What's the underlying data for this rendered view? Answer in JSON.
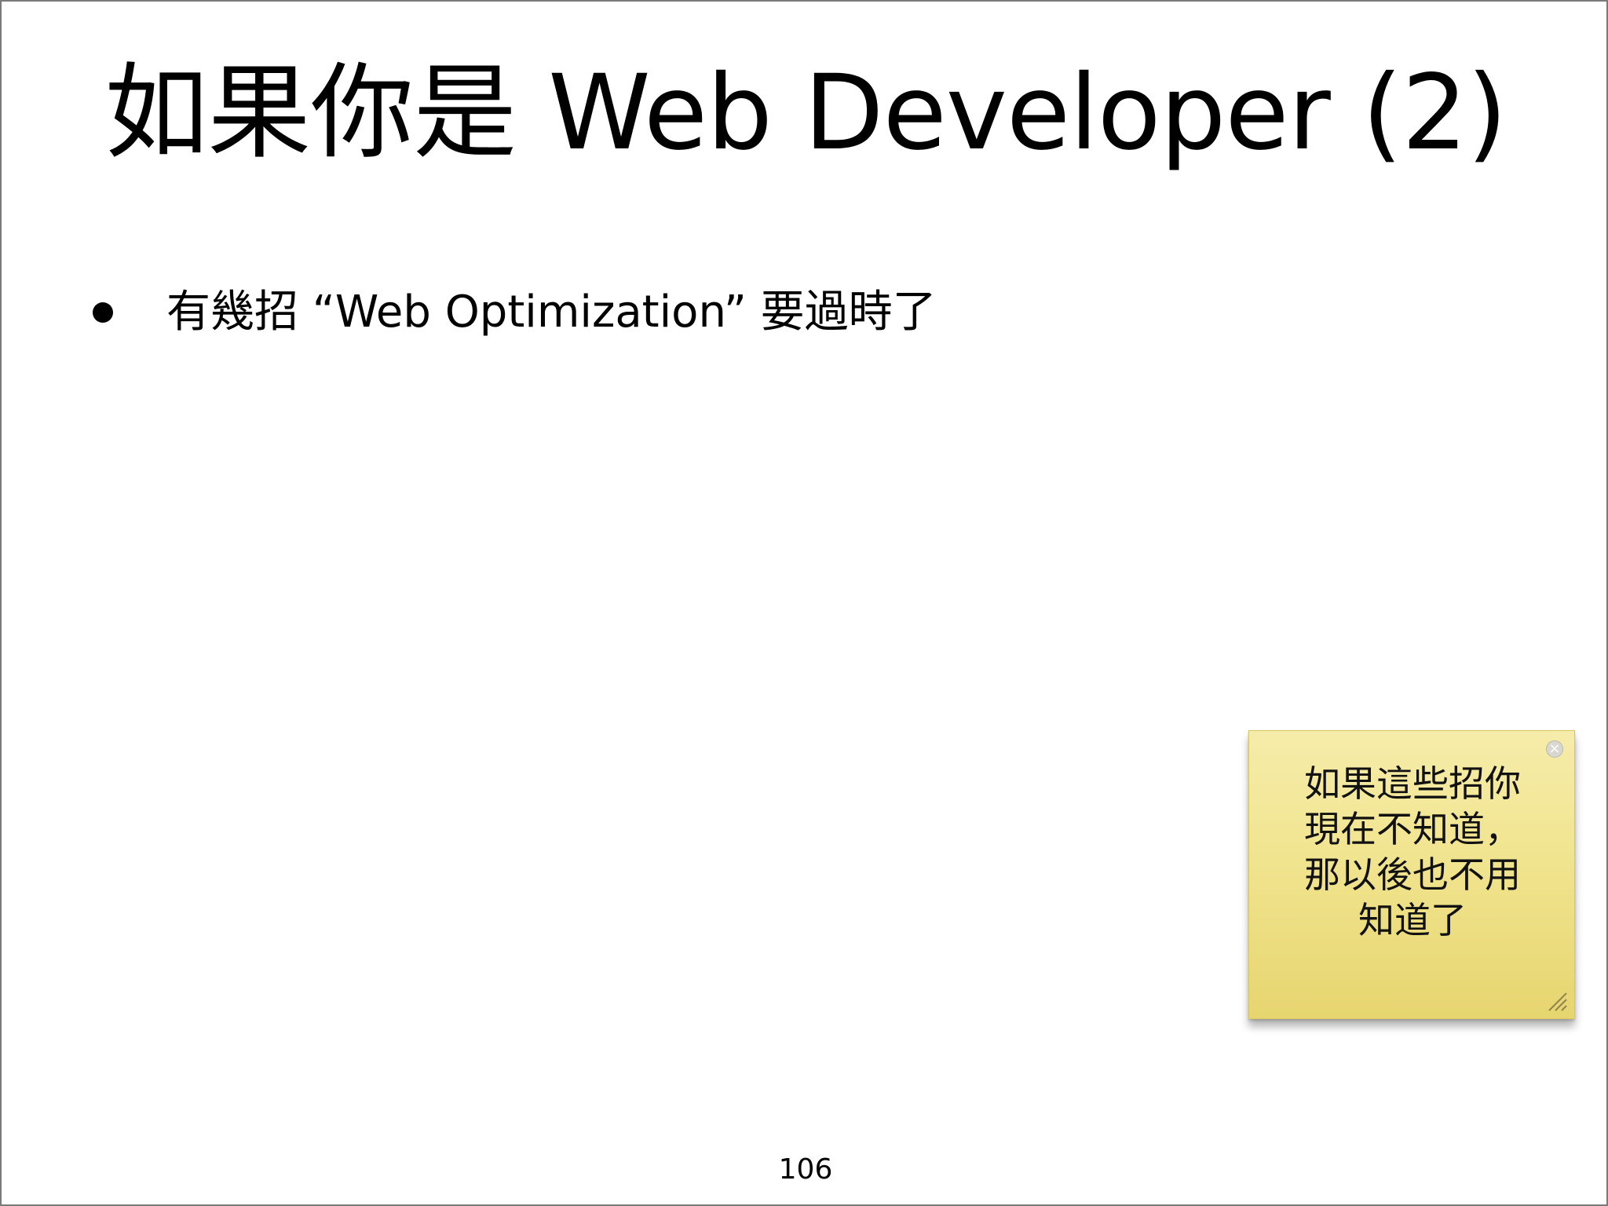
{
  "slide": {
    "title": "如果你是 Web Developer (2)",
    "bullets": [
      "有幾招 “Web Optimization” 要過時了"
    ],
    "sticky_note": {
      "text": "如果這些招你\n現在不知道，\n那以後也不用\n知道了",
      "close_symbol": "×"
    },
    "page_number": "106"
  }
}
